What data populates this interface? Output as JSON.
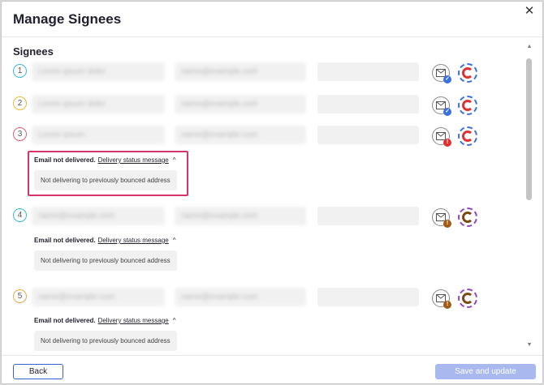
{
  "dialog": {
    "title": "Manage Signees",
    "close_symbol": "✕"
  },
  "section_title": "Signees",
  "signees": [
    {
      "number": "1",
      "name": "Lorem ipsum dolor",
      "email": "name@example.com",
      "mail_status": "delivered",
      "ring_color": "#e03131",
      "num_color": "#3bb9d8"
    },
    {
      "number": "2",
      "name": "Lorem ipsum dolor",
      "email": "name@example.com",
      "mail_status": "delivered",
      "ring_color": "#e03131",
      "num_color": "#e7b93a"
    },
    {
      "number": "3",
      "name": "Lorem ipsum",
      "email": "name@example.com",
      "mail_status": "error",
      "ring_color": "#e03131",
      "num_color": "#e06070"
    },
    {
      "number": "4",
      "name": "name@example.com",
      "email": "name@example.com",
      "mail_status": "warning",
      "ring_color": "#7a4a14",
      "num_color": "#3bb9d8"
    },
    {
      "number": "5",
      "name": "name@example.com",
      "email": "name@example.com",
      "mail_status": "warning",
      "ring_color": "#7a4a14",
      "num_color": "#e7a84a"
    }
  ],
  "errors": [
    {
      "label": "Email not delivered.",
      "link": "Delivery status message",
      "message": "Not delivering to previously bounced address"
    },
    {
      "label": "Email not delivered.",
      "link": "Delivery status message",
      "message": "Not delivering to previously bounced address"
    },
    {
      "label": "Email not delivered.",
      "link": "Delivery status message",
      "message": "Not delivering to previously bounced address"
    }
  ],
  "footer": {
    "back_label": "Back",
    "save_label": "Save and update"
  },
  "colors": {
    "accent": "#3b5fd4",
    "save_disabled": "#a9b9ef",
    "highlight": "#d6336c",
    "blue_check": "#3b6fe0",
    "error_red": "#e03131",
    "warning_brown": "#a05a14"
  }
}
